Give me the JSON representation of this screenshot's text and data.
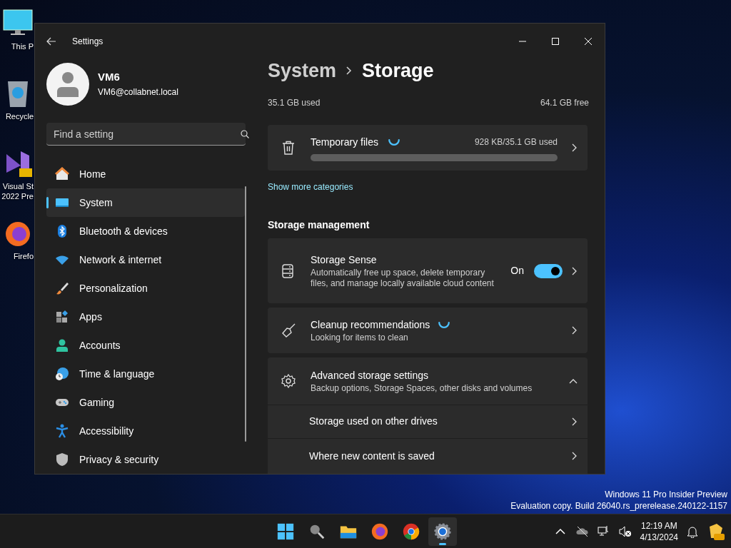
{
  "desktop_icons": [
    {
      "kind": "monitor",
      "lines": [
        "This P"
      ]
    },
    {
      "kind": "recycle",
      "lines": [
        "Recycle"
      ]
    },
    {
      "kind": "vs",
      "lines": [
        "Visual St",
        "2022 Pre"
      ]
    },
    {
      "kind": "firefox",
      "lines": [
        "Firefo"
      ]
    }
  ],
  "window": {
    "title": "Settings"
  },
  "account": {
    "name": "VM6",
    "email": "VM6@collabnet.local"
  },
  "search": {
    "placeholder": "Find a setting"
  },
  "nav": [
    {
      "kind": "home",
      "label": "Home",
      "selected": false
    },
    {
      "kind": "system",
      "label": "System",
      "selected": true
    },
    {
      "kind": "bluetooth",
      "label": "Bluetooth & devices",
      "selected": false
    },
    {
      "kind": "network",
      "label": "Network & internet",
      "selected": false
    },
    {
      "kind": "personalization",
      "label": "Personalization",
      "selected": false
    },
    {
      "kind": "apps",
      "label": "Apps",
      "selected": false
    },
    {
      "kind": "accounts",
      "label": "Accounts",
      "selected": false
    },
    {
      "kind": "time",
      "label": "Time & language",
      "selected": false
    },
    {
      "kind": "gaming",
      "label": "Gaming",
      "selected": false
    },
    {
      "kind": "accessibility",
      "label": "Accessibility",
      "selected": false
    },
    {
      "kind": "privacy",
      "label": "Privacy & security",
      "selected": false
    }
  ],
  "breadcrumb": {
    "parent": "System",
    "current": "Storage"
  },
  "usage": {
    "used": "35.1 GB used",
    "free": "64.1 GB free"
  },
  "temp_files": {
    "title": "Temporary files",
    "reading": "928 KB/35.1 GB used",
    "level": 0.0
  },
  "show_more": "Show more categories",
  "section_title": "Storage management",
  "cards": [
    {
      "kind": "toggle",
      "title": "Storage Sense",
      "description": "Automatically free up space, delete temporary files, and manage locally available cloud content",
      "toggle_label": "On",
      "on": true
    },
    {
      "kind": "loading",
      "title": "Cleanup recommendations",
      "description": "Looking for items to clean"
    },
    {
      "kind": "expander",
      "title": "Advanced storage settings",
      "description": "Backup options, Storage Spaces, other disks and volumes",
      "expanded": true,
      "children": [
        {
          "title": "Storage used on other drives"
        },
        {
          "title": "Where new content is saved"
        }
      ]
    }
  ],
  "watermark": [
    "Windows 11 Pro Insider Preview",
    "Evaluation copy. Build 26040.rs_prerelease.240122-1157"
  ],
  "taskbar": {
    "apps": [
      {
        "kind": "start",
        "selected": false
      },
      {
        "kind": "search",
        "selected": false
      },
      {
        "kind": "explorer",
        "selected": false
      },
      {
        "kind": "firefox",
        "selected": false
      },
      {
        "kind": "chrome",
        "selected": false
      },
      {
        "kind": "settings",
        "selected": true
      }
    ],
    "tray": [
      {
        "kind": "chevron"
      },
      {
        "kind": "cloud"
      },
      {
        "kind": "network"
      },
      {
        "kind": "volume"
      }
    ],
    "time": "12:19 AM",
    "date": "4/13/2024"
  }
}
